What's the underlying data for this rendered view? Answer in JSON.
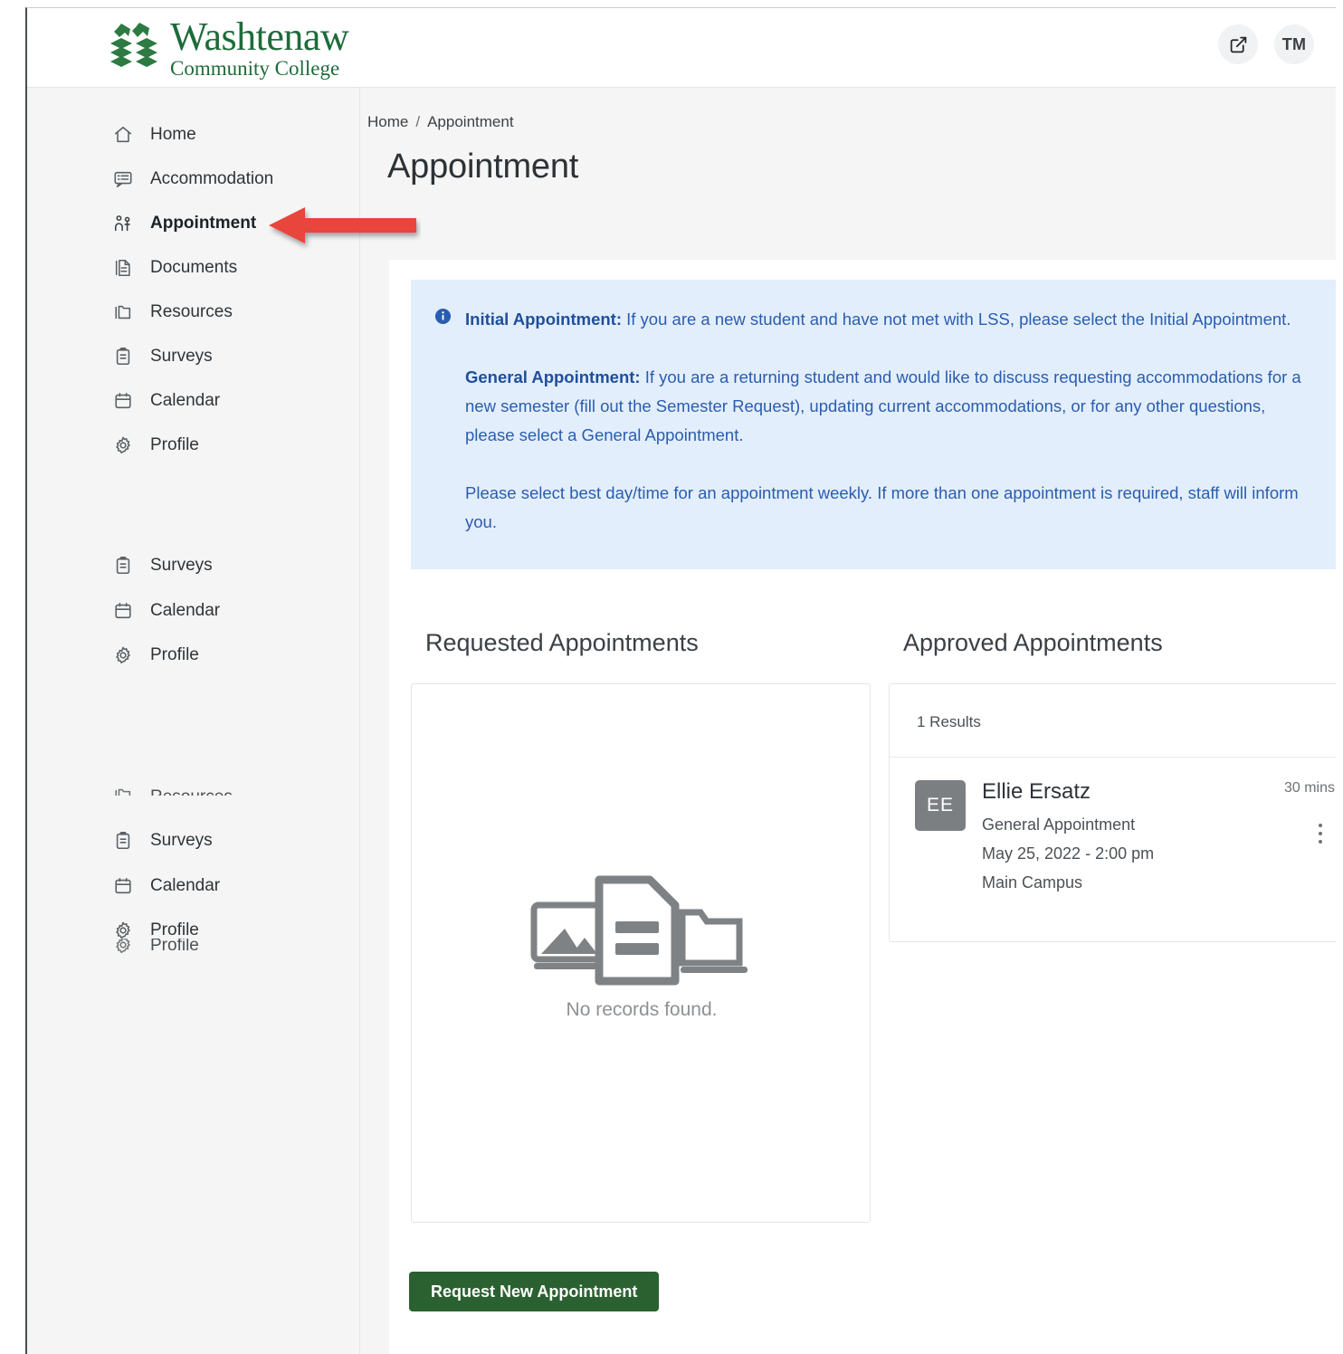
{
  "header": {
    "logo_line1": "Washtenaw",
    "logo_line2": "Community College",
    "logo_icon": "washtenaw-tree-logo",
    "external_link_icon": "external-link-icon",
    "avatar_initials": "TM",
    "brand_green": "#1e6b3a"
  },
  "sidebar": {
    "items": [
      {
        "label": "Home",
        "icon": "home-icon",
        "active": false
      },
      {
        "label": "Accommodation",
        "icon": "accommodation-icon",
        "active": false
      },
      {
        "label": "Appointment",
        "icon": "appointment-icon",
        "active": true
      },
      {
        "label": "Documents",
        "icon": "documents-icon",
        "active": false
      },
      {
        "label": "Resources",
        "icon": "resources-icon",
        "active": false
      },
      {
        "label": "Surveys",
        "icon": "surveys-icon",
        "active": false
      },
      {
        "label": "Calendar",
        "icon": "calendar-icon",
        "active": false
      },
      {
        "label": "Profile",
        "icon": "profile-gear-icon",
        "active": false
      }
    ],
    "repeat_group_1": [
      {
        "label": "Surveys",
        "icon": "surveys-icon"
      },
      {
        "label": "Calendar",
        "icon": "calendar-icon"
      },
      {
        "label": "Profile",
        "icon": "profile-gear-icon"
      }
    ],
    "repeat_group_2": [
      {
        "label": "Resources",
        "icon": "resources-icon"
      },
      {
        "label": "Surveys",
        "icon": "surveys-icon"
      },
      {
        "label": "Calendar",
        "icon": "calendar-icon"
      },
      {
        "label": "Profile",
        "icon": "profile-gear-icon"
      },
      {
        "label": "Profile",
        "icon": "profile-gear-icon"
      }
    ]
  },
  "breadcrumb": {
    "home": "Home",
    "separator": "/",
    "current": "Appointment"
  },
  "page": {
    "title": "Appointment"
  },
  "alert": {
    "icon": "info-circle-icon",
    "accent": "#2a5db0",
    "background": "#e3eefc",
    "p1_bold": "Initial Appointment:",
    "p1_text": " If you are a new student and have not met with LSS, please select the Initial Appointment.",
    "p2_bold": "General Appointment:",
    "p2_text": " If you are a returning student and would like to discuss requesting accommodations for a new semester (fill out the Semester Request), updating current accommodations, or for any other questions, please select a General Appointment.",
    "p3_text": "Please select best day/time for an appointment weekly. If more than one appointment is required, staff will inform you."
  },
  "requested": {
    "title": "Requested Appointments",
    "empty_icon": "no-records-illustration",
    "empty_text": "No records found.",
    "button_label": "Request New Appointment",
    "button_color": "#2b6130"
  },
  "approved": {
    "title": "Approved Appointments",
    "results_label": "1 Results",
    "appointment": {
      "avatar_initials": "EE",
      "name": "Ellie Ersatz",
      "type": "General Appointment",
      "datetime": "May 25, 2022 - 2:00 pm",
      "location": "Main Campus",
      "duration": "30 mins",
      "menu_icon": "kebab-menu-icon"
    }
  },
  "annotation": {
    "arrow_icon": "red-arrow-left",
    "arrow_color": "#e8453c",
    "points_to": "Appointment"
  }
}
